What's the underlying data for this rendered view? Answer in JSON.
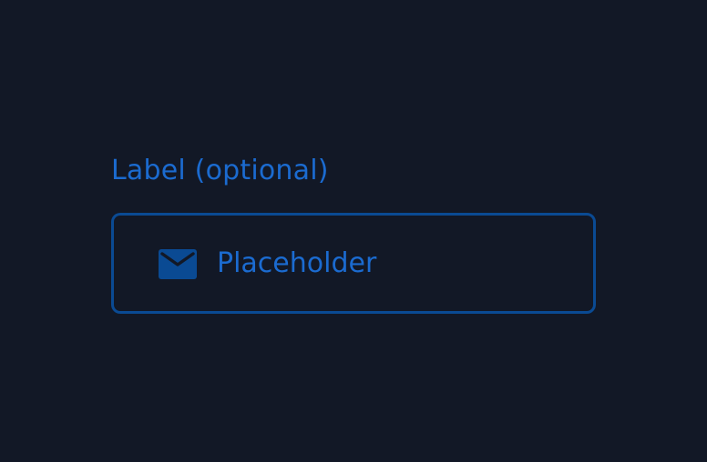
{
  "field": {
    "label": "Label (optional)",
    "placeholder": "Placeholder",
    "value": "",
    "icon": "mail-icon"
  },
  "colors": {
    "background": "#121826",
    "label": "#1b6bd0",
    "border": "#0a4a93",
    "icon": "#0a4a93",
    "placeholder": "#1b6bd0"
  }
}
